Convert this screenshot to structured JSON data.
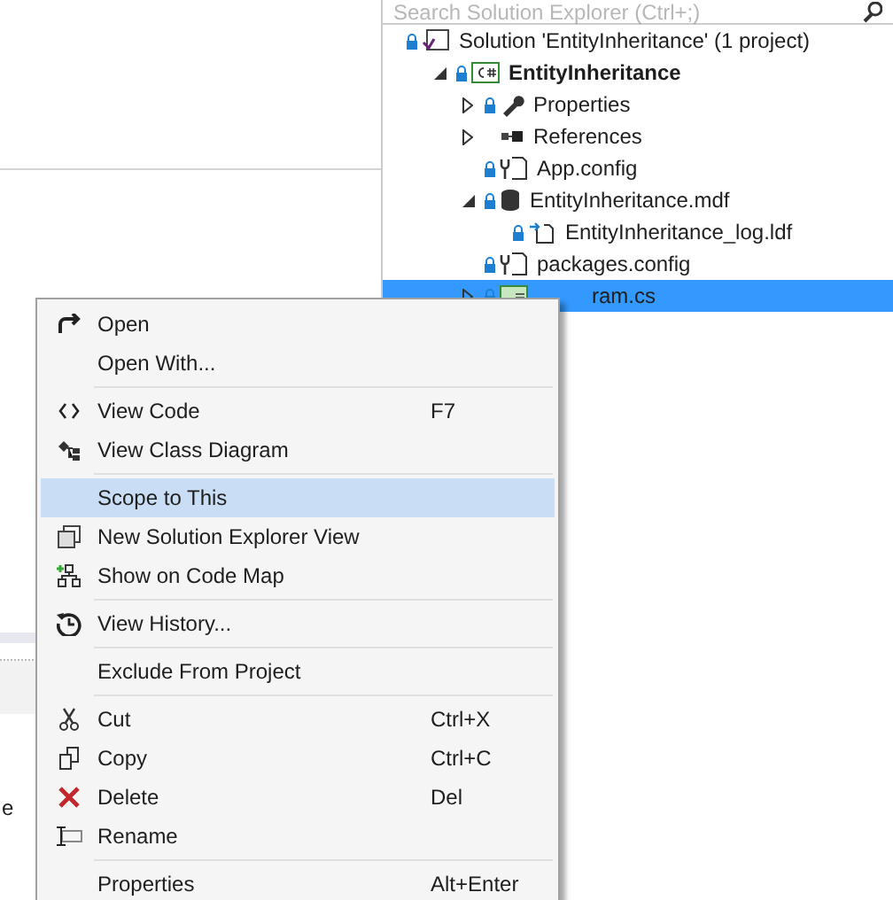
{
  "solution_explorer": {
    "search": {
      "placeholder": "Search Solution Explorer (Ctrl+;)"
    },
    "tree": [
      {
        "label": "Solution 'EntityInheritance' (1 project)",
        "kind": "solution",
        "locked": true,
        "selected": false,
        "children": [
          {
            "label": "EntityInheritance",
            "kind": "csproj",
            "locked": true,
            "bold": true,
            "expanded": true,
            "selected": false,
            "children": [
              {
                "label": "Properties",
                "kind": "properties",
                "locked": true,
                "expanded": false,
                "selected": false
              },
              {
                "label": "References",
                "kind": "references",
                "locked": false,
                "expanded": false,
                "selected": false
              },
              {
                "label": "App.config",
                "kind": "config",
                "locked": true,
                "selected": false
              },
              {
                "label": "EntityInheritance.mdf",
                "kind": "database",
                "locked": true,
                "expanded": true,
                "selected": false,
                "children": [
                  {
                    "label": "EntityInheritance_log.ldf",
                    "kind": "ldf",
                    "locked": true,
                    "selected": false
                  }
                ]
              },
              {
                "label": "packages.config",
                "kind": "config",
                "locked": true,
                "selected": false
              },
              {
                "label": "ram.cs",
                "kind": "csharp",
                "locked": true,
                "expanded": false,
                "selected": true
              }
            ]
          }
        ]
      }
    ]
  },
  "background_text": "e",
  "context_menu": [
    {
      "kind": "item",
      "label": "Open",
      "selected": false
    },
    {
      "kind": "item",
      "label": "Open With...",
      "selected": false
    },
    {
      "kind": "separator"
    },
    {
      "kind": "item",
      "label": "View Code",
      "shortcut": "F7",
      "selected": false
    },
    {
      "kind": "item",
      "label": "View Class Diagram",
      "selected": false
    },
    {
      "kind": "separator"
    },
    {
      "kind": "item",
      "label": "Scope to This",
      "selected": true
    },
    {
      "kind": "item",
      "label": "New Solution Explorer View",
      "selected": false
    },
    {
      "kind": "item",
      "label": "Show on Code Map",
      "selected": false
    },
    {
      "kind": "separator"
    },
    {
      "kind": "item",
      "label": "View History...",
      "selected": false
    },
    {
      "kind": "separator"
    },
    {
      "kind": "item",
      "label": "Exclude From Project",
      "selected": false
    },
    {
      "kind": "separator"
    },
    {
      "kind": "item",
      "label": "Cut",
      "shortcut": "Ctrl+X",
      "selected": false
    },
    {
      "kind": "item",
      "label": "Copy",
      "shortcut": "Ctrl+C",
      "selected": false
    },
    {
      "kind": "item",
      "label": "Delete",
      "shortcut": "Del",
      "selected": false
    },
    {
      "kind": "item",
      "label": "Rename",
      "selected": false
    },
    {
      "kind": "separator"
    },
    {
      "kind": "item",
      "label": "Properties",
      "shortcut": "Alt+Enter",
      "selected": false
    }
  ]
}
